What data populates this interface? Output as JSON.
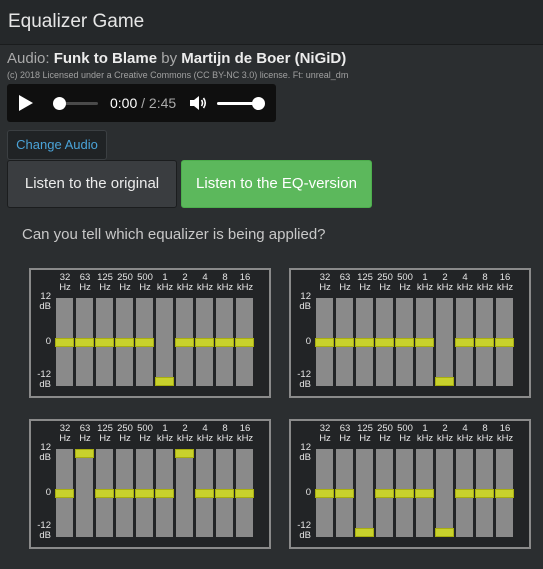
{
  "app": {
    "title": "Equalizer Game"
  },
  "audio": {
    "prefix": "Audio: ",
    "song": "Funk to Blame",
    "by": " by ",
    "artist": "Martijn de Boer (NiGiD)",
    "license": "(c) 2018 Licensed under a Creative Commons (CC BY-NC 3.0) license. Ft: unreal_dm"
  },
  "player": {
    "current_time": "0:00",
    "separator": " / ",
    "duration": "2:45",
    "progress": 0,
    "volume": 1
  },
  "buttons": {
    "change_audio": "Change Audio",
    "listen_original": "Listen to the original",
    "listen_eq": "Listen to the EQ-version"
  },
  "question": "Can you tell which equalizer is being applied?",
  "eq": {
    "bands": [
      {
        "top": "32",
        "bottom": "Hz"
      },
      {
        "top": "63",
        "bottom": "Hz"
      },
      {
        "top": "125",
        "bottom": "Hz"
      },
      {
        "top": "250",
        "bottom": "Hz"
      },
      {
        "top": "500",
        "bottom": "Hz"
      },
      {
        "top": "1",
        "bottom": "kHz"
      },
      {
        "top": "2",
        "bottom": "kHz"
      },
      {
        "top": "4",
        "bottom": "kHz"
      },
      {
        "top": "8",
        "bottom": "kHz"
      },
      {
        "top": "16",
        "bottom": "kHz"
      }
    ],
    "db_labels": {
      "top_value": "12",
      "top_unit": "dB",
      "zero": "0",
      "bottom_value": "-12",
      "bottom_unit": "dB"
    },
    "gain_range_db": [
      -12,
      12
    ],
    "options": [
      {
        "gains_db": [
          0,
          0,
          0,
          0,
          0,
          -12,
          0,
          0,
          0,
          0
        ]
      },
      {
        "gains_db": [
          0,
          0,
          0,
          0,
          0,
          0,
          -12,
          0,
          0,
          0
        ]
      },
      {
        "gains_db": [
          0,
          12,
          0,
          0,
          0,
          0,
          12,
          0,
          0,
          0
        ]
      },
      {
        "gains_db": [
          0,
          0,
          -12,
          0,
          0,
          0,
          -12,
          0,
          0,
          0
        ]
      }
    ]
  },
  "colors": {
    "accent_green": "#5cb85c",
    "link_blue": "#4aa3d8",
    "knob_yellow": "#c8d12c",
    "bar_gray": "#8a8a8a"
  }
}
